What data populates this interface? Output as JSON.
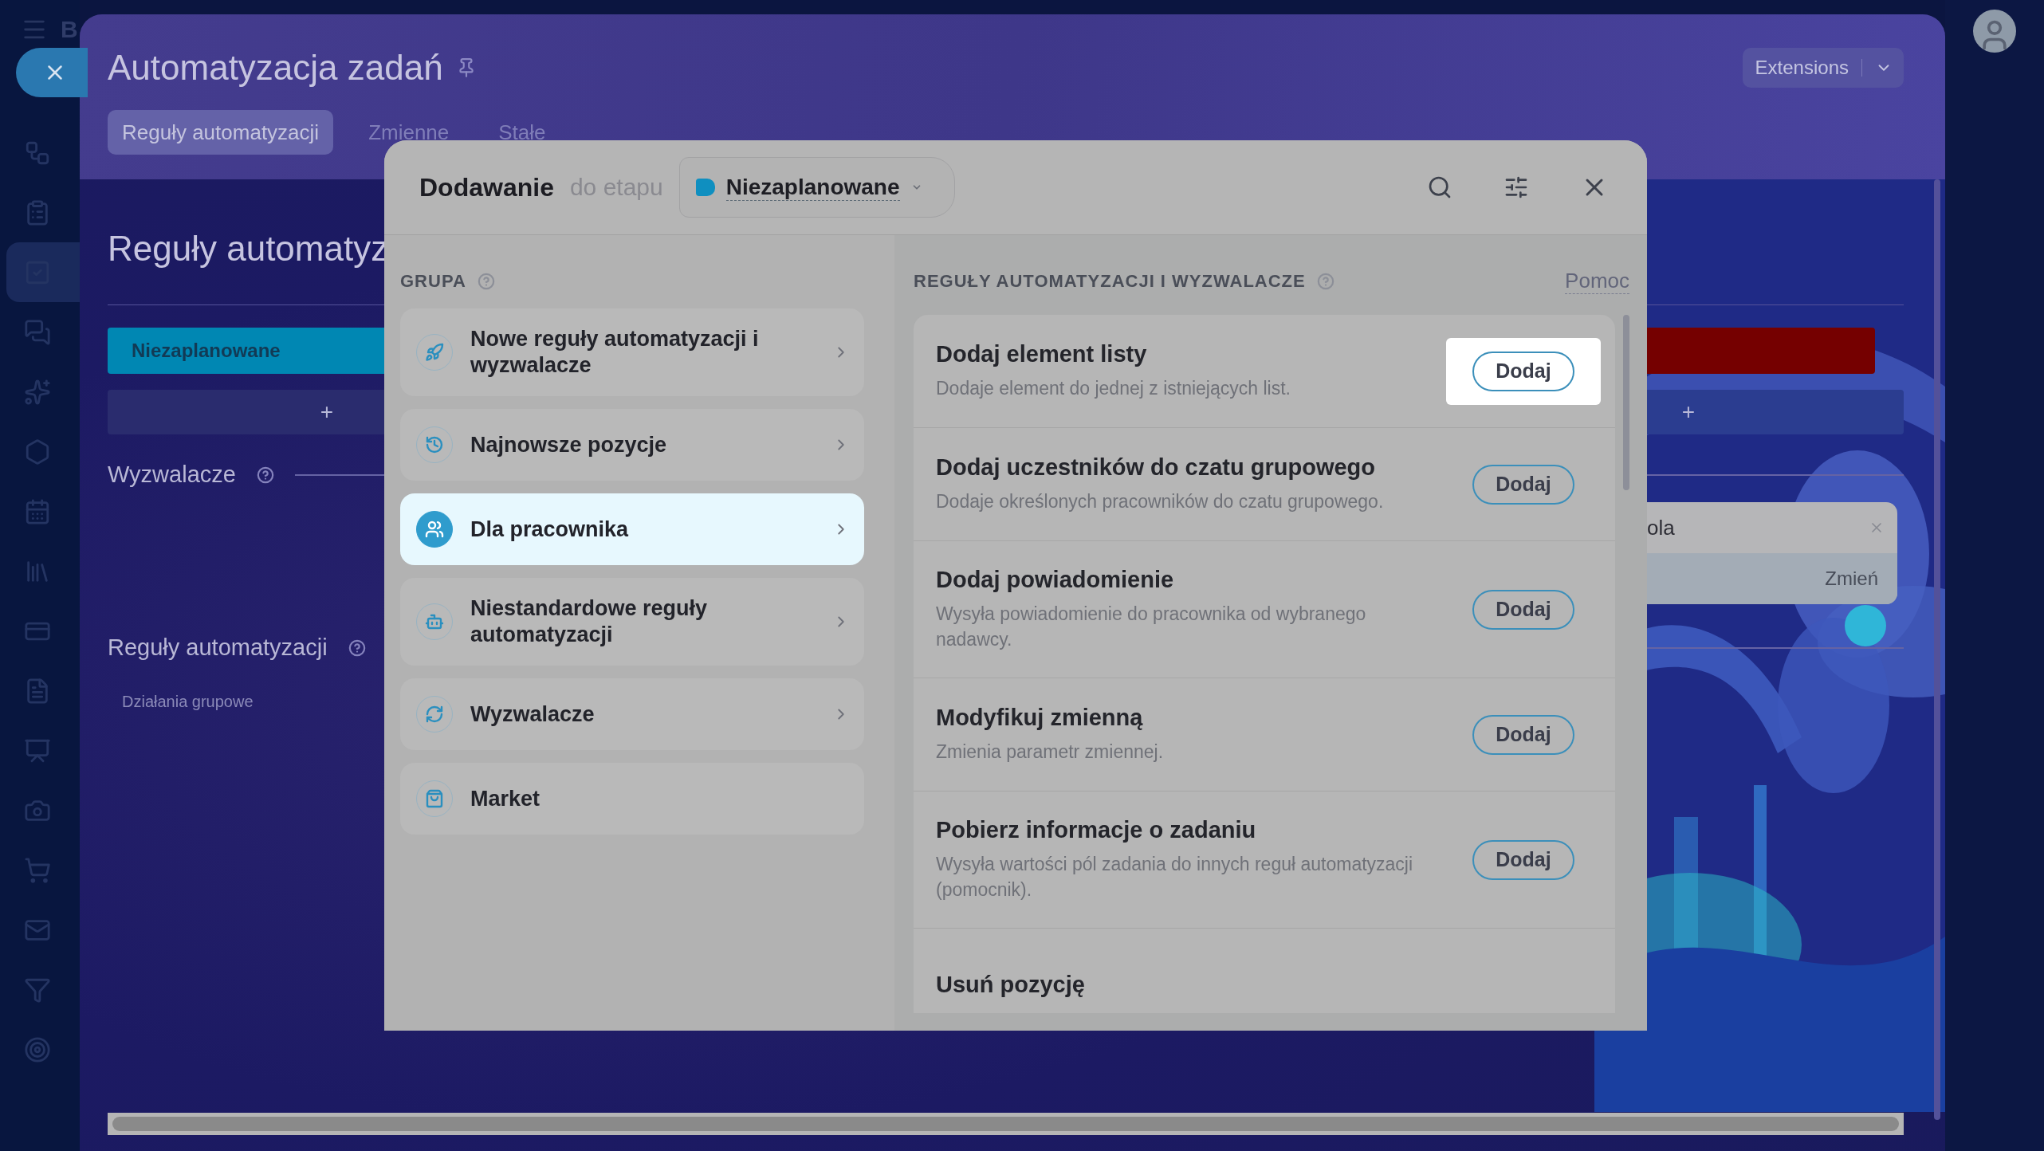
{
  "sidebar": {
    "brand_letter": "B",
    "items": [
      {
        "kind": "workflow",
        "selected": false
      },
      {
        "kind": "clipboard",
        "selected": false
      },
      {
        "kind": "check",
        "selected": true
      },
      {
        "kind": "chat",
        "selected": false
      },
      {
        "kind": "star",
        "selected": false
      },
      {
        "kind": "hexagon",
        "selected": false
      },
      {
        "kind": "calendar",
        "selected": false
      },
      {
        "kind": "books",
        "selected": false
      },
      {
        "kind": "card",
        "selected": false
      },
      {
        "kind": "document",
        "selected": false
      },
      {
        "kind": "board",
        "selected": false
      },
      {
        "kind": "camera",
        "selected": false
      },
      {
        "kind": "cart",
        "selected": false
      },
      {
        "kind": "mail",
        "selected": false
      },
      {
        "kind": "filter",
        "selected": false
      },
      {
        "kind": "target",
        "selected": false
      }
    ]
  },
  "page": {
    "title": "Automatyzacja zadań",
    "tabs": [
      {
        "label": "Reguły automatyzacji",
        "selected": true
      },
      {
        "label": "Zmienne",
        "selected": false
      },
      {
        "label": "Stałe",
        "selected": false
      }
    ],
    "extensions": "Extensions",
    "heading": "Reguły automatyz",
    "stage": {
      "label": "Niezaplanowane",
      "color": "#0087b3"
    },
    "second_stage": {
      "color": "#750000"
    },
    "add_left": "+",
    "add_right": "+",
    "triggers_label": "Wyzwalacze",
    "card": {
      "text": "ola",
      "button": "Zmień"
    },
    "rules_label": "Reguły automatyzacji",
    "group_actions": "Działania grupowe"
  },
  "modal": {
    "title": "Dodawanie",
    "subtitle": "do etapu",
    "stage": {
      "label": "Niezaplanowane",
      "color": "#0f8fc0"
    },
    "groups_heading": "GRUPA",
    "groups": [
      {
        "kind": "rocket",
        "label": "Nowe reguły automatyzacji i wyzwalacze",
        "selected": false,
        "arrow": true
      },
      {
        "kind": "history",
        "label": "Najnowsze pozycje",
        "selected": false,
        "arrow": true
      },
      {
        "kind": "people",
        "label": "Dla pracownika",
        "selected": true,
        "arrow": true
      },
      {
        "kind": "robot",
        "label": "Niestandardowe reguły automatyzacji",
        "selected": false,
        "arrow": true
      },
      {
        "kind": "cycle",
        "label": "Wyzwalacze",
        "selected": false,
        "arrow": true
      },
      {
        "kind": "bag",
        "label": "Market",
        "selected": false,
        "arrow": false
      }
    ],
    "rules_heading": "REGUŁY AUTOMATYZACJI I WYZWALACZE",
    "help": "Pomoc",
    "rules": [
      {
        "title": "Dodaj element listy",
        "description": "Dodaje element do jednej z istniejących list.",
        "button": "Dodaj",
        "highlighted": true
      },
      {
        "title": "Dodaj uczestników do czatu grupowego",
        "description": "Dodaje określonych pracowników do czatu grupowego.",
        "button": "Dodaj",
        "highlighted": false
      },
      {
        "title": "Dodaj powiadomienie",
        "description": "Wysyła powiadomienie do pracownika od wybranego nadawcy.",
        "button": "Dodaj",
        "highlighted": false
      },
      {
        "title": "Modyfikuj zmienną",
        "description": "Zmienia parametr zmiennej.",
        "button": "Dodaj",
        "highlighted": false
      },
      {
        "title": "Pobierz informacje o zadaniu",
        "description": "Wysyła wartości pól zadania do innych reguł automatyzacji (pomocnik).",
        "button": "Dodaj",
        "highlighted": false
      },
      {
        "title": "Usuń pozycję",
        "highlighted": false
      }
    ]
  }
}
